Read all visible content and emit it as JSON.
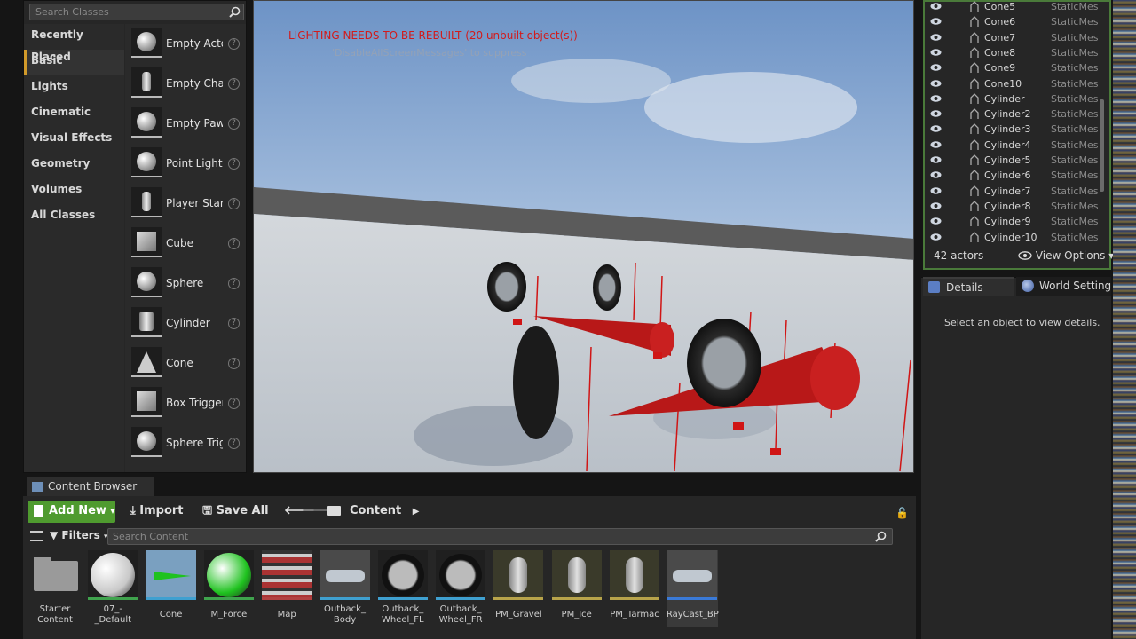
{
  "place_mode": {
    "search_placeholder": "Search Classes",
    "categories": [
      "Recently Placed",
      "Basic",
      "Lights",
      "Cinematic",
      "Visual Effects",
      "Geometry",
      "Volumes",
      "All Classes"
    ],
    "active_category": "Basic",
    "classes": [
      "Empty Actor",
      "Empty Character",
      "Empty Pawn",
      "Point Light",
      "Player Start",
      "Cube",
      "Sphere",
      "Cylinder",
      "Cone",
      "Box Trigger",
      "Sphere Trigger"
    ],
    "help_glyph": "?"
  },
  "viewport": {
    "warning": "LIGHTING NEEDS TO BE REBUILT (20 unbuilt object(s))",
    "suppress": "'DisableAllScreenMessages' to suppress"
  },
  "outliner": {
    "rows": [
      {
        "name": "Cone5",
        "type": "StaticMesh"
      },
      {
        "name": "Cone6",
        "type": "StaticMesh"
      },
      {
        "name": "Cone7",
        "type": "StaticMesh"
      },
      {
        "name": "Cone8",
        "type": "StaticMesh"
      },
      {
        "name": "Cone9",
        "type": "StaticMesh"
      },
      {
        "name": "Cone10",
        "type": "StaticMesh"
      },
      {
        "name": "Cylinder",
        "type": "StaticMesh"
      },
      {
        "name": "Cylinder2",
        "type": "StaticMesh"
      },
      {
        "name": "Cylinder3",
        "type": "StaticMesh"
      },
      {
        "name": "Cylinder4",
        "type": "StaticMesh"
      },
      {
        "name": "Cylinder5",
        "type": "StaticMesh"
      },
      {
        "name": "Cylinder6",
        "type": "StaticMesh"
      },
      {
        "name": "Cylinder7",
        "type": "StaticMesh"
      },
      {
        "name": "Cylinder8",
        "type": "StaticMesh"
      },
      {
        "name": "Cylinder9",
        "type": "StaticMesh"
      },
      {
        "name": "Cylinder10",
        "type": "StaticMesh"
      }
    ],
    "actor_count": "42 actors",
    "view_options": "View Options"
  },
  "details": {
    "tab_details": "Details",
    "tab_world": "World Settings",
    "empty_message": "Select an object to view details."
  },
  "content_browser": {
    "tab": "Content Browser",
    "add_new": "Add New",
    "import": "Import",
    "save_all": "Save All",
    "path": "Content",
    "filters": "Filters",
    "search_placeholder": "Search Content",
    "assets": [
      {
        "name": "Starter Content",
        "kind": "folder",
        "color": "#9a9a9a"
      },
      {
        "name": "07_-_Default",
        "kind": "material",
        "color": "#c8c8c8"
      },
      {
        "name": "Cone",
        "kind": "mesh",
        "color": "#1fc21f"
      },
      {
        "name": "M_Force",
        "kind": "material",
        "color": "#1fc21f"
      },
      {
        "name": "Map",
        "kind": "texture",
        "color": "#aa3333"
      },
      {
        "name": "Outback_ Body",
        "kind": "mesh",
        "color": "#c0c8d0"
      },
      {
        "name": "Outback_ Wheel_FL",
        "kind": "mesh",
        "color": "#bbbbbb"
      },
      {
        "name": "Outback_ Wheel_FR",
        "kind": "mesh",
        "color": "#bbbbbb"
      },
      {
        "name": "PM_Gravel",
        "kind": "physmat",
        "color": "#e0e0e0"
      },
      {
        "name": "PM_Ice",
        "kind": "physmat",
        "color": "#e0e0e0"
      },
      {
        "name": "PM_Tarmac",
        "kind": "physmat",
        "color": "#e0e0e0"
      },
      {
        "name": "RayCast_BP",
        "kind": "blueprint",
        "color": "#c0c8d0"
      }
    ]
  }
}
